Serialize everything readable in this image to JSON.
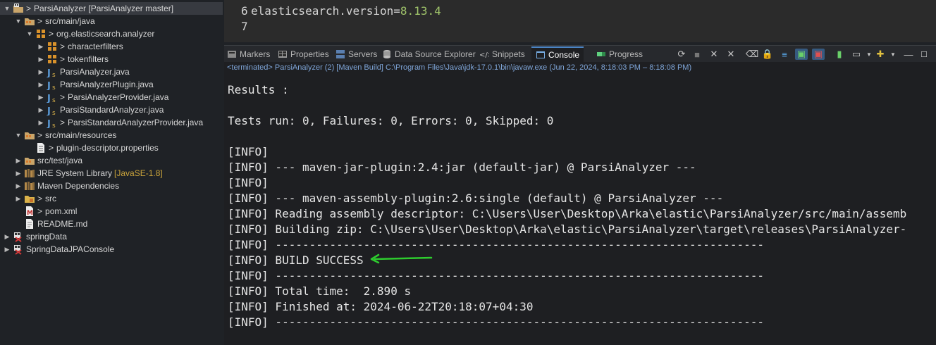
{
  "explorer": {
    "items": [
      {
        "level": 0,
        "arrow": "down",
        "icon": "project-icon",
        "dirty": ">",
        "label": "ParsiAnalyzer [ParsiAnalyzer master]",
        "deco": "",
        "selected": true
      },
      {
        "level": 1,
        "arrow": "down",
        "icon": "source-folder-icon",
        "dirty": ">",
        "label": "src/main/java",
        "deco": ""
      },
      {
        "level": 2,
        "arrow": "down",
        "icon": "package-icon",
        "dirty": ">",
        "label": "org.elasticsearch.analyzer",
        "deco": ""
      },
      {
        "level": 3,
        "arrow": "right",
        "icon": "package-icon",
        "dirty": ">",
        "label": "characterfilters",
        "deco": ""
      },
      {
        "level": 3,
        "arrow": "right",
        "icon": "package-icon",
        "dirty": ">",
        "label": "tokenfilters",
        "deco": ""
      },
      {
        "level": 3,
        "arrow": "right",
        "icon": "java-file-icon",
        "dirty": "",
        "label": "ParsiAnalyzer.java",
        "deco": ""
      },
      {
        "level": 3,
        "arrow": "right",
        "icon": "java-file-icon",
        "dirty": "",
        "label": "ParsiAnalyzerPlugin.java",
        "deco": ""
      },
      {
        "level": 3,
        "arrow": "right",
        "icon": "java-file-icon",
        "dirty": ">",
        "label": "ParsiAnalyzerProvider.java",
        "deco": ""
      },
      {
        "level": 3,
        "arrow": "right",
        "icon": "java-file-icon",
        "dirty": "",
        "label": "ParsiStandardAnalyzer.java",
        "deco": ""
      },
      {
        "level": 3,
        "arrow": "right",
        "icon": "java-file-icon",
        "dirty": ">",
        "label": "ParsiStandardAnalyzerProvider.java",
        "deco": ""
      },
      {
        "level": 1,
        "arrow": "down",
        "icon": "source-folder-icon",
        "dirty": ">",
        "label": "src/main/resources",
        "deco": ""
      },
      {
        "level": 2,
        "arrow": "none",
        "icon": "properties-file-icon",
        "dirty": ">",
        "label": "plugin-descriptor.properties",
        "deco": ""
      },
      {
        "level": 1,
        "arrow": "right",
        "icon": "source-folder-icon",
        "dirty": "",
        "label": "src/test/java",
        "deco": ""
      },
      {
        "level": 1,
        "arrow": "right",
        "icon": "library-icon",
        "dirty": "",
        "label": "JRE System Library",
        "deco": "[JavaSE-1.8]"
      },
      {
        "level": 1,
        "arrow": "right",
        "icon": "library-icon",
        "dirty": "",
        "label": "Maven Dependencies",
        "deco": ""
      },
      {
        "level": 1,
        "arrow": "right",
        "icon": "folder-icon",
        "dirty": ">",
        "label": "src",
        "deco": ""
      },
      {
        "level": 1,
        "arrow": "none",
        "icon": "xml-file-icon",
        "dirty": ">",
        "label": "pom.xml",
        "deco": ""
      },
      {
        "level": 1,
        "arrow": "none",
        "icon": "text-file-icon",
        "dirty": "",
        "label": "README.md",
        "deco": ""
      },
      {
        "level": 0,
        "arrow": "right",
        "icon": "closed-project-icon",
        "dirty": "",
        "label": "springData",
        "deco": ""
      },
      {
        "level": 0,
        "arrow": "right",
        "icon": "closed-project-icon",
        "dirty": "",
        "label": "SpringDataJPAConsole",
        "deco": ""
      }
    ]
  },
  "editor": {
    "lines": [
      {
        "num": "6",
        "key": "elasticsearch.version=",
        "value": "8.13.4"
      },
      {
        "num": "7",
        "key": "",
        "value": ""
      }
    ]
  },
  "viewbar": {
    "tabs": [
      {
        "label": "Markers",
        "icon": "markers-icon"
      },
      {
        "label": "Properties",
        "icon": "properties-icon"
      },
      {
        "label": "Servers",
        "icon": "servers-icon"
      },
      {
        "label": "Data Source Explorer",
        "icon": "data-source-icon"
      },
      {
        "label": "Snippets",
        "icon": "snippets-icon"
      },
      {
        "label": "Console",
        "icon": "console-icon",
        "active": true
      },
      {
        "label": "Progress",
        "icon": "progress-icon"
      }
    ]
  },
  "console": {
    "header": "<terminated> ParsiAnalyzer (2) [Maven Build] C:\\Program Files\\Java\\jdk-17.0.1\\bin\\javaw.exe  (Jun 22, 2024, 8:18:03 PM – 8:18:08 PM)",
    "lines": [
      "Results :",
      "",
      "Tests run: 0, Failures: 0, Errors: 0, Skipped: 0",
      "",
      "[INFO]",
      "[INFO] --- maven-jar-plugin:2.4:jar (default-jar) @ ParsiAnalyzer ---",
      "[INFO]",
      "[INFO] --- maven-assembly-plugin:2.6:single (default) @ ParsiAnalyzer ---",
      "[INFO] Reading assembly descriptor: C:\\Users\\User\\Desktop\\Arka\\elastic\\ParsiAnalyzer/src/main/assemb",
      "[INFO] Building zip: C:\\Users\\User\\Desktop\\Arka\\elastic\\ParsiAnalyzer\\target\\releases\\ParsiAnalyzer-",
      "[INFO] ------------------------------------------------------------------------",
      "[INFO] BUILD SUCCESS",
      "[INFO] ------------------------------------------------------------------------",
      "[INFO] Total time:  2.890 s",
      "[INFO] Finished at: 2024-06-22T20:18:07+04:30",
      "[INFO] ------------------------------------------------------------------------"
    ]
  },
  "colors": {
    "annotation_arrow": "#2ecc2e",
    "active_tab_accent": "#4b84c4"
  }
}
